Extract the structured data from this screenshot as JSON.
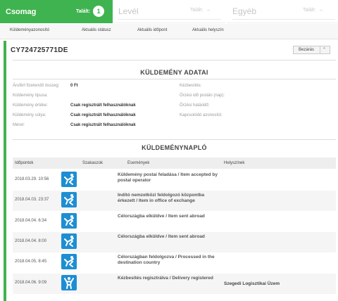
{
  "tabs": [
    {
      "title": "Csomag",
      "count_label": "Talált:",
      "count": "1",
      "active": true
    },
    {
      "title": "Levél",
      "count_label": "Talált:",
      "count": "–",
      "active": false
    },
    {
      "title": "Egyéb",
      "count_label": "Talált:",
      "count": "–",
      "active": false
    }
  ],
  "columns": [
    "Küldeményazonosító",
    "Aktuális státusz",
    "Aktuális időpont",
    "Aktuális helyszín"
  ],
  "shipment": {
    "tracking_number": "CY724725771DE",
    "close_label": "Bezárás"
  },
  "details": {
    "title": "KÜLDEMÉNY ADATAI",
    "left": [
      {
        "label": "Árufért fizetendő összeg:",
        "value": "0 Ft"
      },
      {
        "label": "Küldemény típusa:",
        "value": ""
      },
      {
        "label": "Küldemény értéke:",
        "value": "Csak regisztrált felhasználóknak"
      },
      {
        "label": "Küldemény súlya:",
        "value": "Csak regisztrált felhasználóknak"
      },
      {
        "label": "Méret:",
        "value": "Csak regisztrált felhasználóknak"
      }
    ],
    "right": [
      {
        "label": "Kézbesítés:"
      },
      {
        "label": "Őrzési idő postán (nap):"
      },
      {
        "label": "Őrzési határidő:"
      },
      {
        "label": "Kapcsolódó azonosító:"
      }
    ]
  },
  "log": {
    "title": "KÜLDEMÉNYNAPLÓ",
    "headers": [
      "Időpontok",
      "Szakaszok",
      "Események",
      "Helyszínek"
    ],
    "rows": [
      {
        "date": "2018.03.29. 10:56",
        "icon": "handover-icon",
        "event": "Küldemény postai feladása / Item accepted by postal operator",
        "place": ""
      },
      {
        "date": "2018.04.03. 23:37",
        "icon": "handover-icon",
        "event": "Indító nemzetközi feldolgozó központba érkezett / Item in office of exchange",
        "place": ""
      },
      {
        "date": "2018.04.04. 6:34",
        "icon": "handover-icon",
        "event": "Célországba elküldve / Item sent abroad",
        "place": ""
      },
      {
        "date": "2018.04.04. 8:00",
        "icon": "handover-icon",
        "event": "Célországba elküldve / Item sent abroad",
        "place": ""
      },
      {
        "date": "2018.04.05. 8:45",
        "icon": "handover-icon",
        "event": "Célországban feldolgozva / Processed in the destination country",
        "place": ""
      },
      {
        "date": "2018.04.06. 9:09",
        "icon": "delivered-icon",
        "event": "Kézbesítés regisztrálva / Delivery registered",
        "place": "Szegedi Logisztikai Üzem"
      }
    ]
  },
  "colors": {
    "accent": "#3fb34f",
    "icon_bg": "#1e8ed3"
  }
}
